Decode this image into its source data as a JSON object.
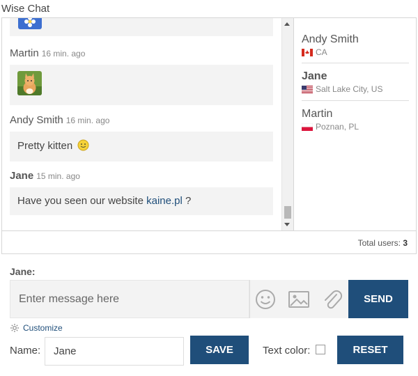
{
  "app": {
    "title": "Wise Chat"
  },
  "messages": [
    {
      "author": "Martin",
      "time": "16 min. ago",
      "type": "image",
      "image": "kitten-thumbnail"
    },
    {
      "author": "Andy Smith",
      "time": "16 min. ago",
      "type": "text",
      "text": "Pretty kitten",
      "emoji": "smiley-emoji"
    },
    {
      "author": "Jane",
      "time": "15 min. ago",
      "type": "text",
      "text_before": "Have you seen our website",
      "link": "kaine.pl",
      "text_after": "?"
    }
  ],
  "users": [
    {
      "name": "Andy Smith",
      "location": "CA",
      "flag": "canada-flag"
    },
    {
      "name": "Jane",
      "location": "Salt Lake City, US",
      "flag": "usa-flag"
    },
    {
      "name": "Martin",
      "location": "Poznan, PL",
      "flag": "poland-flag"
    }
  ],
  "totals": {
    "label": "Total users:",
    "count": "3"
  },
  "composer": {
    "current_user": "Jane:",
    "placeholder": "Enter message here",
    "send_label": "SEND",
    "icons": [
      "emoticon-icon",
      "image-icon",
      "attachment-icon"
    ]
  },
  "customize": {
    "link_label": "Customize",
    "name_label": "Name:",
    "name_value": "Jane",
    "save_label": "SAVE",
    "text_color_label": "Text color:",
    "reset_label": "RESET"
  },
  "colors": {
    "accent": "#1f4e7a",
    "bubble": "#f3f3f3",
    "link": "#1f4e7a"
  }
}
